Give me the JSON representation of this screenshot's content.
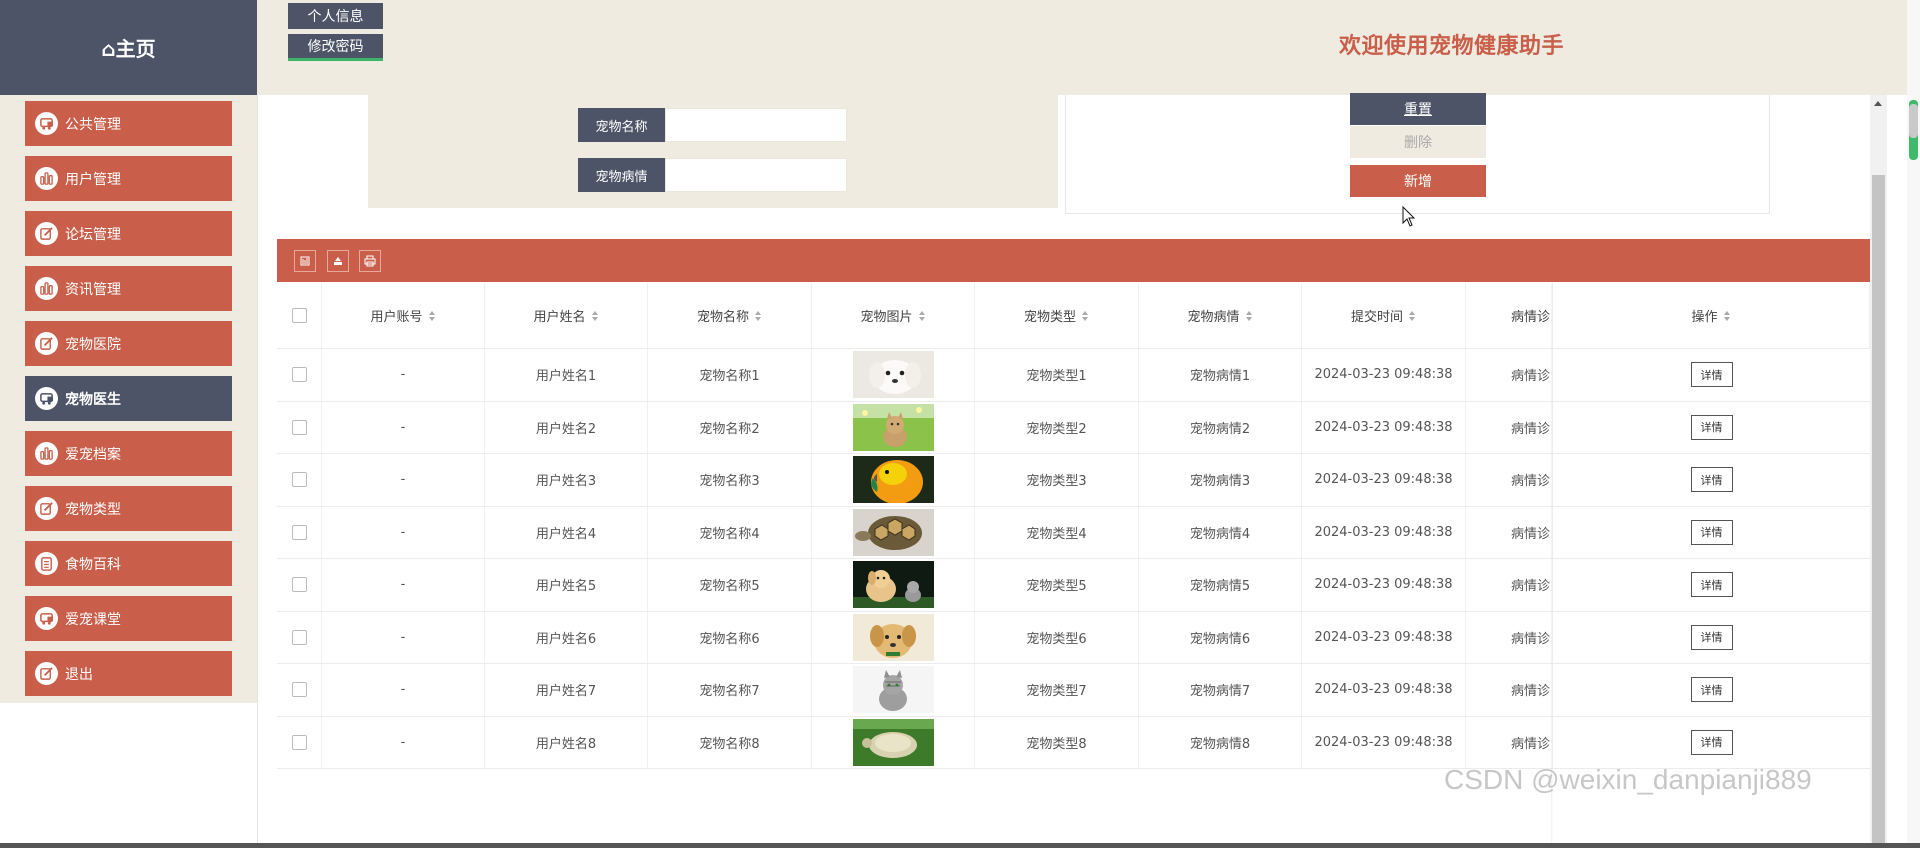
{
  "header": {
    "logo_text": "⌂主页",
    "btn_profile": "个人信息",
    "btn_password": "修改密码",
    "welcome": "欢迎使用宠物健康助手"
  },
  "sidebar": {
    "items": [
      {
        "label": "公共管理",
        "icon": "cart-icon"
      },
      {
        "label": "用户管理",
        "icon": "bar-chart-icon"
      },
      {
        "label": "论坛管理",
        "icon": "edit-icon"
      },
      {
        "label": "资讯管理",
        "icon": "bar-chart-icon"
      },
      {
        "label": "宠物医院",
        "icon": "edit-icon"
      },
      {
        "label": "宠物医生",
        "icon": "cart-icon",
        "active": true
      },
      {
        "label": "爱宠档案",
        "icon": "bar-chart-icon"
      },
      {
        "label": "宠物类型",
        "icon": "edit-icon"
      },
      {
        "label": "食物百科",
        "icon": "clipboard-icon"
      },
      {
        "label": "爱宠课堂",
        "icon": "cart-icon"
      },
      {
        "label": "退出",
        "icon": "edit-icon"
      }
    ]
  },
  "search": {
    "name_label": "宠物名称",
    "name_value": "",
    "condition_label": "宠物病情",
    "condition_value": ""
  },
  "actions": {
    "reset": "重置",
    "delete": "删除",
    "add": "新增"
  },
  "toolbar": {
    "icons": [
      "export-icon",
      "import-icon",
      "print-icon"
    ]
  },
  "table": {
    "headers": [
      "用户账号",
      "用户姓名",
      "宠物名称",
      "宠物图片",
      "宠物类型",
      "宠物病情",
      "提交时间",
      "病情诊",
      "操作"
    ],
    "detail_label": "详情",
    "rows": [
      {
        "account": "-",
        "user": "用户姓名1",
        "pet": "宠物名称1",
        "image": "white-puppy",
        "type": "宠物类型1",
        "condition": "宠物病情1",
        "time": "2024-03-23 09:48:38",
        "diag": "病情诊"
      },
      {
        "account": "-",
        "user": "用户姓名2",
        "pet": "宠物名称2",
        "image": "kitten-on-grass",
        "type": "宠物类型2",
        "condition": "宠物病情2",
        "time": "2024-03-23 09:48:38",
        "diag": "病情诊"
      },
      {
        "account": "-",
        "user": "用户姓名3",
        "pet": "宠物名称3",
        "image": "orange-parrot",
        "type": "宠物类型3",
        "condition": "宠物病情3",
        "time": "2024-03-23 09:48:38",
        "diag": "病情诊"
      },
      {
        "account": "-",
        "user": "用户姓名4",
        "pet": "宠物名称4",
        "image": "tortoise",
        "type": "宠物类型4",
        "condition": "宠物病情4",
        "time": "2024-03-23 09:48:38",
        "diag": "病情诊"
      },
      {
        "account": "-",
        "user": "用户姓名5",
        "pet": "宠物名称5",
        "image": "puppy-and-kitten",
        "type": "宠物类型5",
        "condition": "宠物病情5",
        "time": "2024-03-23 09:48:38",
        "diag": "病情诊"
      },
      {
        "account": "-",
        "user": "用户姓名6",
        "pet": "宠物名称6",
        "image": "cream-puppy",
        "type": "宠物类型6",
        "condition": "宠物病情6",
        "time": "2024-03-23 09:48:38",
        "diag": "病情诊"
      },
      {
        "account": "-",
        "user": "用户姓名7",
        "pet": "宠物名称7",
        "image": "tabby-cat",
        "type": "宠物类型7",
        "condition": "宠物病情7",
        "time": "2024-03-23 09:48:38",
        "diag": "病情诊"
      },
      {
        "account": "-",
        "user": "用户姓名8",
        "pet": "宠物名称8",
        "image": "turtle-on-grass",
        "type": "宠物类型8",
        "condition": "宠物病情8",
        "time": "2024-03-23 09:48:38",
        "diag": "病情诊"
      }
    ]
  },
  "watermark": "CSDN @weixin_danpianji889",
  "colors": {
    "accent": "#c95f4a",
    "dark": "#4d5467",
    "panel": "#f0ebe0",
    "active_underline": "#3eb36a"
  }
}
